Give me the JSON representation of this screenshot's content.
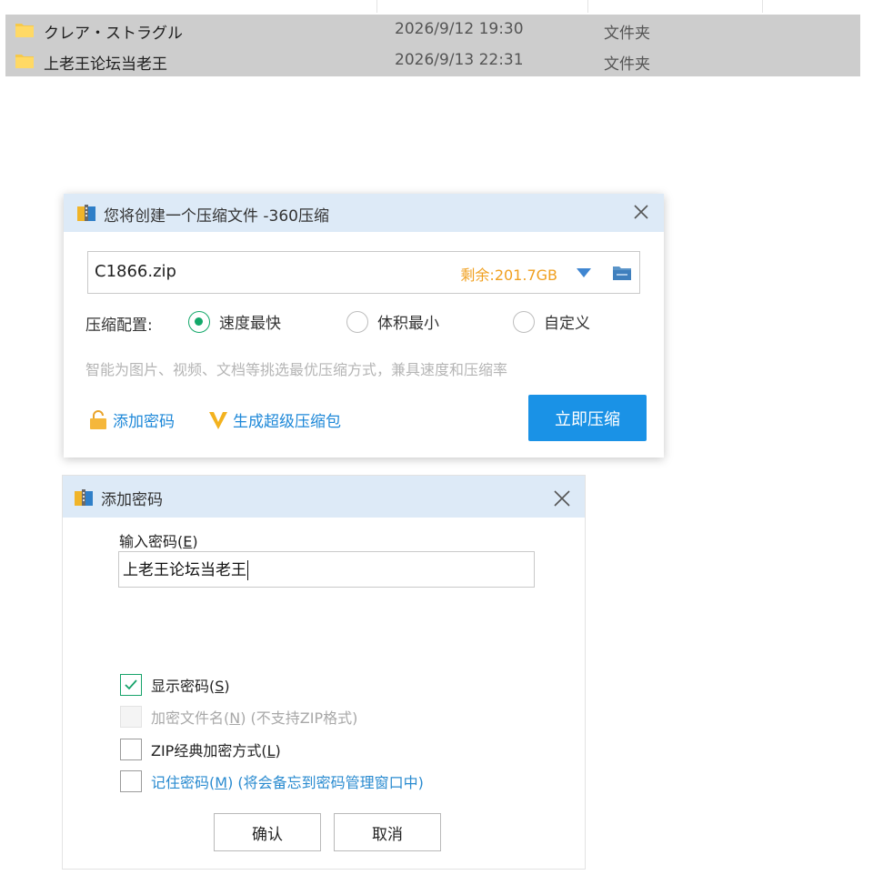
{
  "explorer": {
    "rows": [
      {
        "name": "クレア・ストラグル",
        "date": "2026/9/12 19:30",
        "type": "文件夹"
      },
      {
        "name": "上老王论坛当老王",
        "date": "2026/9/13 22:31",
        "type": "文件夹"
      }
    ]
  },
  "compress_dialog": {
    "title": "您将创建一个压缩文件 -360压缩",
    "filename": "C1866.zip",
    "free_space": "剩余:201.7GB",
    "config_label": "压缩配置:",
    "options": [
      {
        "label": "速度最快",
        "selected": true
      },
      {
        "label": "体积最小",
        "selected": false
      },
      {
        "label": "自定义",
        "selected": false
      }
    ],
    "hint": "智能为图片、视频、文档等挑选最优压缩方式，兼具速度和压缩率",
    "add_password_link": "添加密码",
    "super_pack_link": "生成超级压缩包",
    "compress_button": "立即压缩"
  },
  "password_dialog": {
    "title": "添加密码",
    "input_label_prefix": "输入密码(",
    "input_label_key": "E",
    "input_label_suffix": ")",
    "password_value": "上老王论坛当老王",
    "checkboxes": [
      {
        "prefix": "显示密码(",
        "key": "S",
        "suffix": ")",
        "checked": true,
        "disabled": false
      },
      {
        "prefix": "加密文件名(",
        "key": "N",
        "suffix": ") (不支持ZIP格式)",
        "checked": false,
        "disabled": true
      },
      {
        "prefix": "ZIP经典加密方式(",
        "key": "L",
        "suffix": ")",
        "checked": false,
        "disabled": false
      },
      {
        "prefix": "记住密码(",
        "key": "M",
        "suffix": ") (将会备忘到密码管理窗口中)",
        "checked": false,
        "disabled": false
      }
    ],
    "ok_button": "确认",
    "cancel_button": "取消"
  },
  "colors": {
    "accent_blue": "#1a92e6",
    "link_blue": "#1e88d8",
    "radio_green": "#13a86a",
    "free_space_orange": "#f0a020",
    "title_bar": "#ddeaf7"
  },
  "icons": [
    "folder-icon",
    "archive-app-icon",
    "close-icon",
    "chevron-down-icon",
    "folder-browse-icon",
    "lock-icon",
    "vip-v-icon",
    "check-icon"
  ]
}
